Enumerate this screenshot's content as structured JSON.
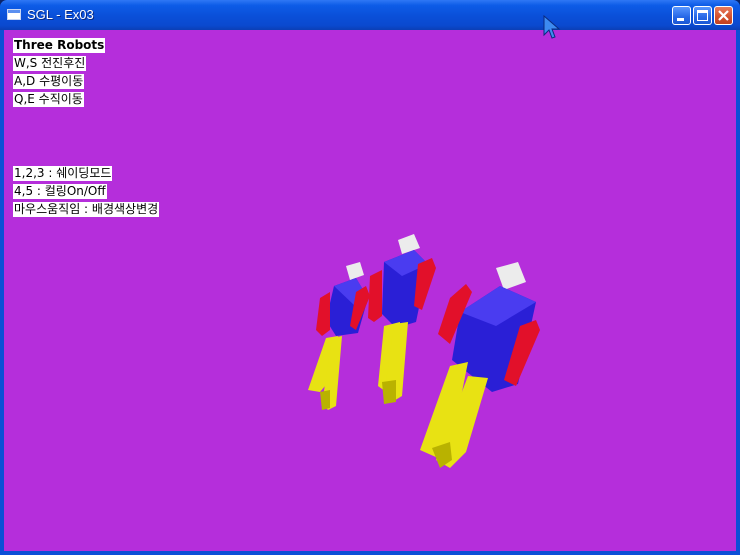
{
  "window": {
    "title": "SGL - Ex03",
    "controls": [
      "minimize",
      "maximize",
      "close"
    ]
  },
  "hud": {
    "lines": [
      "Three Robots",
      "W,S 전진후진",
      "A,D 수평이동",
      "Q,E 수직이동",
      "1,2,3 : 쉐이딩모드",
      "4,5 : 컬링On/Off",
      "마우스움직임 : 배경색상변경"
    ]
  },
  "scene": {
    "robot_count": 3,
    "colors": {
      "background": "#b52edb",
      "head": "#ececec",
      "body": "#2a1fd6",
      "arms": "#e2102a",
      "legs": "#e8e213"
    }
  },
  "cursor": {
    "icon": "arrow-cursor-icon"
  }
}
